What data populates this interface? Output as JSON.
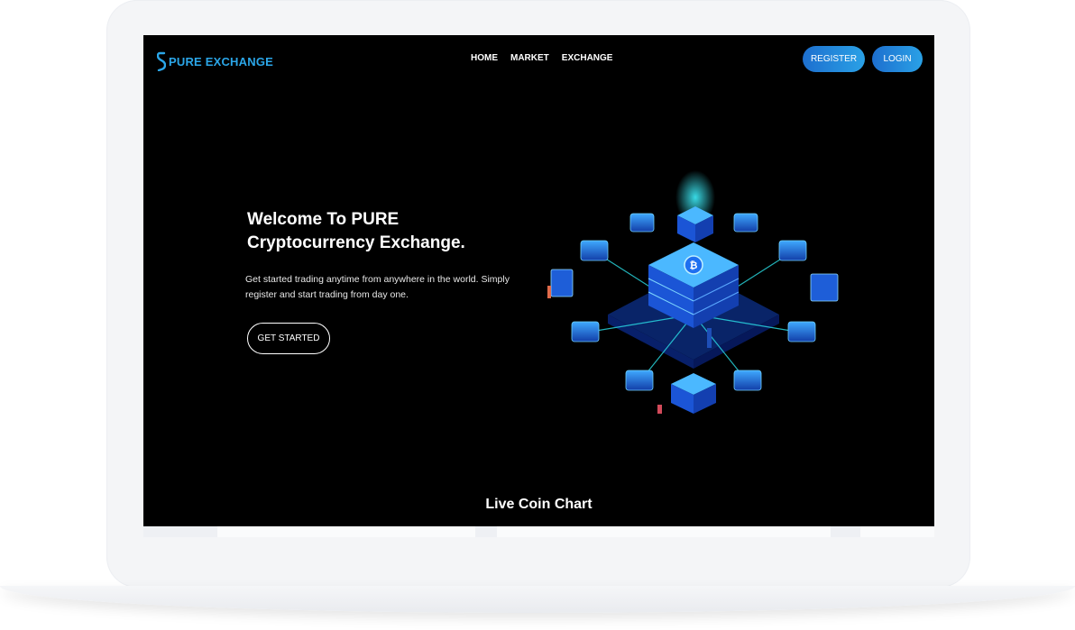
{
  "brand": {
    "name": "PURE EXCHANGE",
    "color": "#2ba6e8"
  },
  "nav": {
    "links": [
      "HOME",
      "MARKET",
      "EXCHANGE"
    ]
  },
  "auth": {
    "register_label": "REGISTER",
    "login_label": "LOGIN"
  },
  "hero": {
    "title_line1": "Welcome To PURE",
    "title_line2": "Cryptocurrency Exchange.",
    "description": "Get started trading anytime from anywhere in the world. Simply register and start trading from day one.",
    "cta_label": "GET STARTED"
  },
  "live_chart": {
    "heading": "Live Coin Chart"
  },
  "colors": {
    "accent": "#2aa1e6",
    "accent_dark": "#1d6fcf",
    "background": "#000000"
  }
}
